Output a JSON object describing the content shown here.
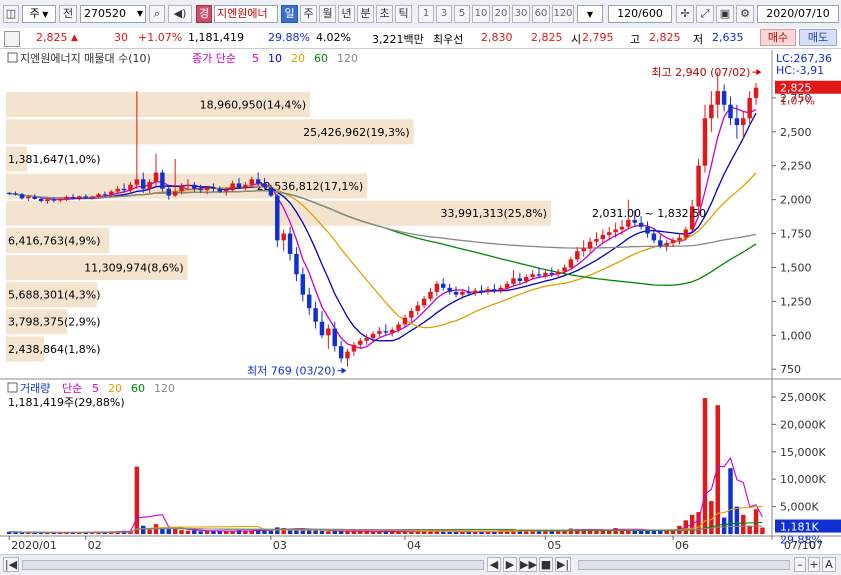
{
  "toolbar": {
    "market": "주",
    "prev_label": "전",
    "code": "270520",
    "sound_icon": "speaker-icon",
    "badge": "경",
    "stock_name": "지엔원에너",
    "periods": [
      "일",
      "주",
      "월",
      "년",
      "분",
      "초",
      "틱"
    ],
    "active_period": "일",
    "numbers": [
      "1",
      "3",
      "5",
      "10",
      "20",
      "30",
      "60",
      "120"
    ],
    "count": "120",
    "count_total": "/600",
    "date": "2020/07/10"
  },
  "quote": {
    "price": "2,825",
    "change": "30",
    "change_pct": "+1.07%",
    "volume": "1,181,419",
    "vol_ratio": "29.88%",
    "turnover": "4.02%",
    "amount": "3,221백만",
    "bid_label": "최우선",
    "ask_price": "2,830",
    "bid_price": "2,825",
    "open_label": "시",
    "open": "2,795",
    "high_label": "고",
    "high": "2,825",
    "low_label": "저",
    "low": "2,635",
    "buy_label": "매수",
    "sell_label": "매도"
  },
  "chart_data": [
    {
      "type": "candlestick",
      "title": "지엔원에너지 매물대 수(10)",
      "legend": {
        "label": "종가 단순",
        "periods": [
          "5",
          "10",
          "20",
          "60",
          "120"
        ],
        "colors": [
          "#cc00cc",
          "#0000cc",
          "#e0a000",
          "#008800",
          "#888888"
        ]
      },
      "ylim": [
        700,
        3000
      ],
      "yticks": [
        750,
        1000,
        1250,
        1500,
        1750,
        2000,
        2250,
        2500,
        2750
      ],
      "ytick_labels": [
        "750",
        "1,000",
        "1,250",
        "1,500",
        "1,750",
        "2,000",
        "2,250",
        "2,500",
        "2,750"
      ],
      "lc_label": "LC:267,36",
      "hc_label": "HC:-3,91",
      "current_price_label": "2,825",
      "current_pct_label": "1.07%",
      "current_price": 2825,
      "high_annotation": {
        "text": "최고 2,940 (07/02)",
        "value": 2940,
        "day": 118
      },
      "low_annotation": {
        "text": "최저 769 (03/20)",
        "value": 769,
        "day": 53
      },
      "range_annotation": {
        "text": "2,031.00 ~ 1,832.50"
      },
      "volume_profile": [
        {
          "label": "18,960,950(14,4%)",
          "pct": 14.4,
          "low": 2600,
          "high": 2800
        },
        {
          "label": "25,426,962(19,3%)",
          "pct": 19.3,
          "low": 2400,
          "high": 2600
        },
        {
          "label": "1,381,647(1,0%)",
          "pct": 1.0,
          "low": 2200,
          "high": 2400
        },
        {
          "label": "22,536,812(17,1%)",
          "pct": 17.1,
          "low": 2000,
          "high": 2200
        },
        {
          "label": "33,991,313(25,8%)",
          "pct": 25.8,
          "low": 1800,
          "high": 2000
        },
        {
          "label": "6,416,763(4,9%)",
          "pct": 4.9,
          "low": 1600,
          "high": 1800
        },
        {
          "label": "11,309,974(8,6%)",
          "pct": 8.6,
          "low": 1400,
          "high": 1600
        },
        {
          "label": "5,688,301(4,3%)",
          "pct": 4.3,
          "low": 1200,
          "high": 1400
        },
        {
          "label": "3,798,375(2,9%)",
          "pct": 2.9,
          "low": 1000,
          "high": 1200
        },
        {
          "label": "2,438,864(1,8%)",
          "pct": 1.8,
          "low": 800,
          "high": 1000
        }
      ],
      "candles_compact": "2050,2055,2035,2045;2045,2060,2030,2040;2040,2050,2000,2010;2010,2030,1990,2020;2020,2040,2000,2005;2005,2020,1980,1990;1990,2010,1970,2000;2000,2015,1980,1995;1995,2010,1980,2005;2005,2030,1990,2020;2020,2040,2000,2010;2010,2030,1995,2025;2025,2040,2005,2015;2015,2030,2000,2020;2020,2050,2010,2040;2040,2060,2020,2035;2035,2070,2020,2060;2060,2100,2040,2080;2080,2120,2050,2070;2070,2130,2040,2110;2110,2800,2080,2150;2150,2200,2050,2080;2080,2150,2050,2130;2130,2340,2100,2200;2200,2220,2060,2080;2080,2100,2000,2030;2030,2300,2020,2060;2060,2120,2040,2100;2100,2150,2070,2110;2110,2130,2060,2080;2080,2110,2050,2070;2070,2100,2040,2090;2090,2120,2060,2080;2080,2100,2050,2060;2060,2090,2030,2070;2070,2140,2060,2120;2120,2160,2080,2090;2090,2130,2070,2110;2110,2170,2090,2150;2150,2200,2100,2120;2120,2160,2080,2090;2090,2110,2020,2030;2030,2040,1650,1700;1700,1780,1620,1750;1750,1800,1550,1600;1600,1650,1400,1450;1450,1500,1250,1300;1300,1350,1150,1200;1200,1250,1050,1100;1100,1180,980,1000;1000,1080,900,1050;1050,1100,880,920;920,960,800,830;830,900,769,880;880,950,850,930;930,980,900,960;960,1010,930,980;980,1030,950,1010;1010,1060,990,1030;1030,1080,1000,1020;1020,1060,990,1040;1040,1100,1020,1080;1080,1150,1060,1130;1130,1200,1100,1180;1180,1250,1150,1220;1220,1290,1200,1270;1270,1350,1250,1320;1320,1400,1290,1380;1380,1420,1330,1350;1350,1380,1300,1320;1320,1360,1280,1300;1300,1340,1270,1320;1320,1360,1290,1310;1310,1350,1290,1330;1330,1370,1300,1320;1320,1360,1300,1340;1340,1380,1310,1330;1330,1370,1310,1350;1350,1400,1330,1380;1380,1480,1360,1420;1420,1460,1380,1400;1400,1450,1380,1430;1430,1480,1410,1450;1450,1500,1420,1440;1440,1480,1420,1460;1460,1500,1430,1450;1450,1490,1420,1470;1470,1520,1450,1500;1500,1580,1480,1560;1560,1650,1540,1620;1620,1700,1580,1640;1640,1720,1610,1690;1690,1760,1660,1710;1710,1780,1680,1740;1740,1800,1700,1760;1760,1830,1720,1780;1780,1850,1740,1800;1800,2000,1780,1850;1850,1920,1800,1830;1830,1880,1780,1800;1800,1840,1720,1750;1750,1790,1680,1700;1700,1740,1640,1660;1660,1700,1620,1680;1680,1720,1650,1700;1700,1750,1670,1720;1720,1800,1700,1780;1780,2000,1760,1950;1950,2300,1900,2250;2250,2700,2200,2600;2600,2800,2500,2700;2700,2940,2600,2800;2800,2850,2650,2700;2700,2760,2550,2600;2600,2700,2450,2550;2550,2650,2450,2600;2600,2800,2550,2750;2750,2860,2700,2825",
      "x_labels": [
        {
          "text": "2020/01",
          "day": 0
        },
        {
          "text": "02",
          "day": 12
        },
        {
          "text": "03",
          "day": 41
        },
        {
          "text": "04",
          "day": 62
        },
        {
          "text": "05",
          "day": 84
        },
        {
          "text": "06",
          "day": 104
        },
        {
          "text": "07",
          "day": 125
        },
        {
          "text": "07/10",
          "day": 133
        }
      ]
    },
    {
      "type": "bar",
      "title": "거래량",
      "legend": {
        "label": "단순",
        "periods": [
          "5",
          "20",
          "60",
          "120"
        ],
        "colors": [
          "#cc00cc",
          "#e0a000",
          "#008800",
          "#888888"
        ]
      },
      "value_label": "1,181,419주(29,88%)",
      "ylim": [
        0,
        27000
      ],
      "yticks": [
        5000,
        10000,
        15000,
        20000,
        25000
      ],
      "ytick_labels": [
        "5,000K",
        "10,000K",
        "15,000K",
        "20,000K",
        "25,000K"
      ],
      "current_label": "1,181K",
      "current_value": 1181,
      "pct_label": "29,88%",
      "volumes_k": [
        400,
        350,
        300,
        280,
        250,
        300,
        220,
        250,
        300,
        280,
        260,
        300,
        320,
        350,
        400,
        380,
        420,
        500,
        600,
        550,
        12300,
        1500,
        800,
        1800,
        1200,
        900,
        900,
        700,
        600,
        650,
        500,
        600,
        550,
        500,
        450,
        600,
        700,
        550,
        650,
        800,
        700,
        650,
        1200,
        1100,
        900,
        1000,
        800,
        700,
        650,
        600,
        500,
        550,
        500,
        600,
        450,
        500,
        500,
        400,
        450,
        400,
        400,
        450,
        500,
        550,
        600,
        650,
        700,
        500,
        450,
        400,
        400,
        420,
        450,
        400,
        420,
        400,
        450,
        600,
        900,
        800,
        700,
        650,
        600,
        550,
        600,
        550,
        650,
        800,
        1000,
        900,
        800,
        700,
        750,
        800,
        700,
        1100,
        900,
        800,
        750,
        700,
        600,
        650,
        700,
        600,
        800,
        1500,
        2500,
        3500,
        4000,
        24800,
        6000,
        23500,
        3000,
        12000,
        5000,
        3500,
        1500,
        4500,
        1181
      ]
    }
  ],
  "bottom_nav": [
    "◀",
    "▶",
    "▶▶",
    "■",
    "▶|",
    "–",
    "+",
    "A"
  ],
  "icons": {
    "settings": "gear-icon",
    "print": "printer-icon",
    "save": "save-icon",
    "dropdown": "chevron-down-icon"
  }
}
